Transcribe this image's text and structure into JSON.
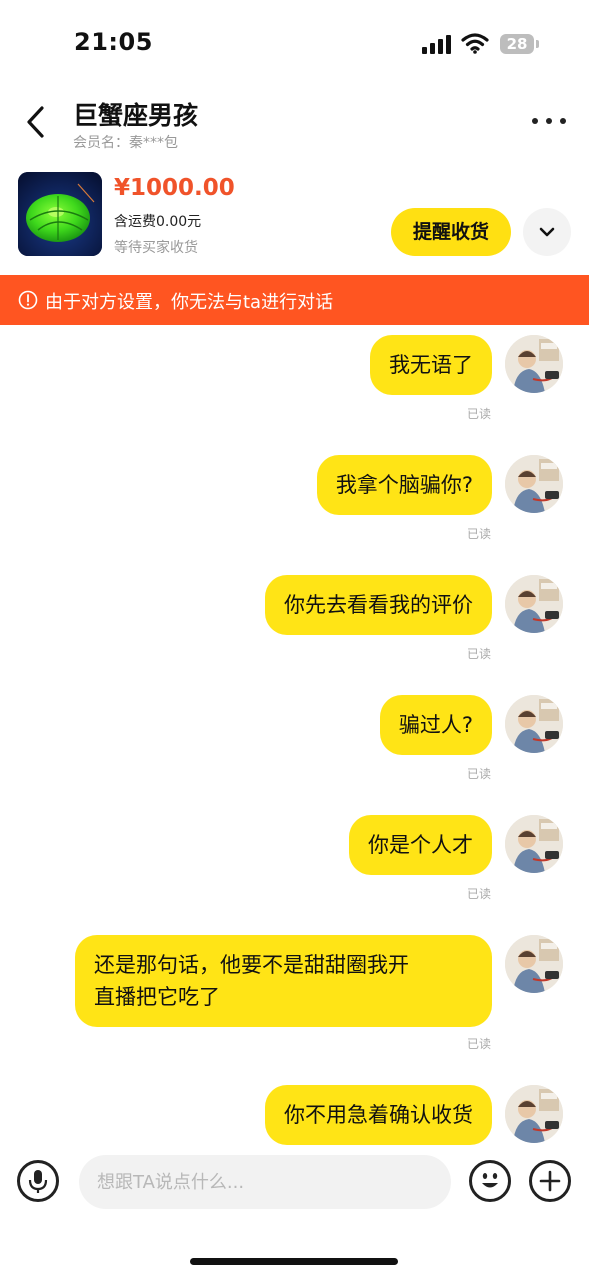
{
  "status_bar": {
    "time": "21:05",
    "battery": "28"
  },
  "header": {
    "title": "巨蟹座男孩",
    "subtitle": "会员名：秦***包"
  },
  "order": {
    "price": "¥1000.00",
    "shipping": "含运费0.00元",
    "status": "等待买家收货",
    "remind_label": "提醒收货"
  },
  "banner": {
    "text": "由于对方设置，你无法与ta进行对话"
  },
  "messages": [
    {
      "lines": [
        "我无语了"
      ],
      "status": "已读"
    },
    {
      "lines": [
        "我拿个脑骗你?"
      ],
      "status": "已读"
    },
    {
      "lines": [
        "你先去看看我的评价"
      ],
      "status": "已读"
    },
    {
      "lines": [
        "骗过人?"
      ],
      "status": "已读"
    },
    {
      "lines": [
        "你是个人才"
      ],
      "status": "已读"
    },
    {
      "lines": [
        "还是那句话，他要不是甜甜圈我开",
        "直播把它吃了"
      ],
      "status": "已读"
    },
    {
      "lines": [
        "你不用急着确认收货"
      ],
      "status": ""
    }
  ],
  "input": {
    "placeholder": "想跟TA说点什么..."
  },
  "colors": {
    "accent_yellow": "#ffe416",
    "banner_red": "#ff5521",
    "price_red": "#f0532a"
  },
  "icons": [
    "back-arrow-icon",
    "more-icon",
    "chevron-down-icon",
    "info-icon",
    "microphone-icon",
    "emoji-icon",
    "plus-icon"
  ]
}
